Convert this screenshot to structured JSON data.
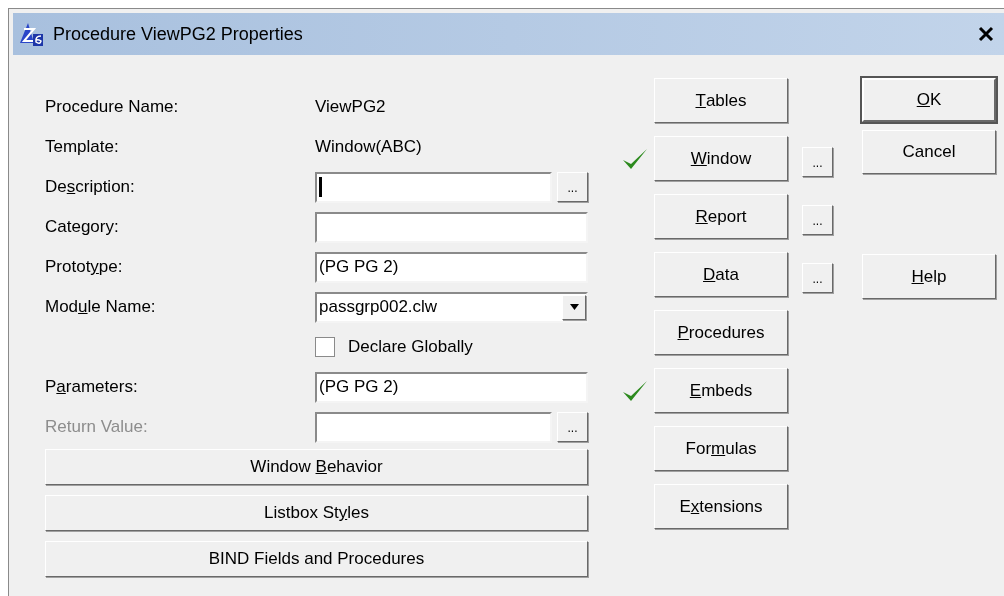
{
  "window": {
    "title": "Procedure ViewPG2 Properties"
  },
  "rows": [
    {
      "kind": "info",
      "label": {
        "pre": "Procedure Name:"
      },
      "value": "ViewPG2"
    },
    {
      "kind": "info",
      "label": {
        "pre": "Template:"
      },
      "value": "Window(ABC)"
    },
    {
      "kind": "input",
      "label": {
        "pre": "De",
        "key": "s",
        "post": "cription:"
      },
      "focused": true,
      "disabled": false,
      "more": "..."
    },
    {
      "kind": "input",
      "label": {
        "pre": "Category:"
      },
      "disabled": false
    },
    {
      "kind": "input",
      "label": {
        "pre": "Protot",
        "key": "y",
        "post": "pe:"
      },
      "value": "(PG PG 2)",
      "disabled": false
    },
    {
      "kind": "dropdown",
      "label": {
        "pre": "Mod",
        "key": "u",
        "post": "le Name:"
      },
      "value": "passgrp002.clw"
    },
    {
      "kind": "checkbox",
      "label": {
        "pre": "Declare Globally"
      },
      "checked": false
    },
    {
      "kind": "input",
      "label": {
        "pre": "P",
        "key": "a",
        "post": "rameters:"
      },
      "value": "(PG PG 2)",
      "disabled": false
    },
    {
      "kind": "input",
      "label": {
        "pre": "Return Value:"
      },
      "disabled": true,
      "more": "..."
    }
  ],
  "wide_buttons": [
    {
      "label": {
        "pre": "Window ",
        "key": "B",
        "post": "ehavior"
      }
    },
    {
      "label": {
        "pre": "Listbox St",
        "key": "y",
        "post": "les"
      }
    },
    {
      "label": {
        "pre": "BIND Fields and Procedures"
      }
    }
  ],
  "section_buttons": [
    {
      "label": {
        "key": "T",
        "post": "ables"
      },
      "checked": false
    },
    {
      "label": {
        "key": "W",
        "post": "indow"
      },
      "checked": true,
      "more": "..."
    },
    {
      "label": {
        "key": "R",
        "post": "eport"
      },
      "checked": false,
      "more": "..."
    },
    {
      "label": {
        "key": "D",
        "post": "ata"
      },
      "checked": false,
      "more": "..."
    },
    {
      "label": {
        "key": "P",
        "post": "rocedures"
      },
      "checked": false
    },
    {
      "label": {
        "key": "E",
        "post": "mbeds"
      },
      "checked": true
    },
    {
      "label": {
        "pre": "For",
        "key": "m",
        "post": "ulas"
      },
      "checked": false
    },
    {
      "label": {
        "pre": "E",
        "key": "x",
        "post": "tensions"
      },
      "checked": false
    }
  ],
  "dialog_buttons": [
    {
      "label": {
        "key": "O",
        "post": "K"
      },
      "default": true
    },
    {
      "label": {
        "pre": "Cancel"
      },
      "default": false
    }
  ],
  "help_button": {
    "label": {
      "key": "H",
      "post": "elp"
    }
  }
}
